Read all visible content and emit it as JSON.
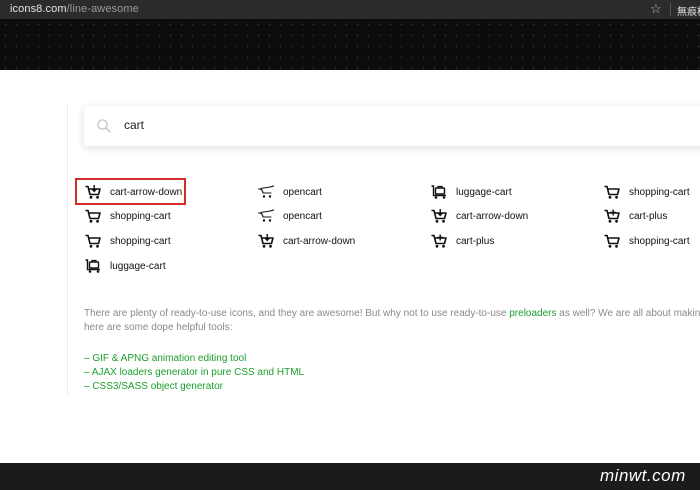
{
  "browser": {
    "url_host": "icons8.com",
    "url_path": "/line-awesome",
    "mode_label": "無痕模式"
  },
  "search": {
    "value": "cart"
  },
  "results": [
    {
      "label": "cart-arrow-down",
      "icon": "cart-arrow-down-icon"
    },
    {
      "label": "opencart",
      "icon": "opencart-icon"
    },
    {
      "label": "luggage-cart",
      "icon": "luggage-cart-icon"
    },
    {
      "label": "shopping-cart",
      "icon": "shopping-cart-icon"
    },
    {
      "label": "shopping-cart",
      "icon": "shopping-cart-icon"
    },
    {
      "label": "opencart",
      "icon": "opencart-icon"
    },
    {
      "label": "cart-arrow-down",
      "icon": "cart-arrow-down-icon"
    },
    {
      "label": "cart-plus",
      "icon": "cart-plus-icon"
    },
    {
      "label": "shopping-cart",
      "icon": "shopping-cart-icon"
    },
    {
      "label": "cart-arrow-down",
      "icon": "cart-arrow-down-icon"
    },
    {
      "label": "cart-plus",
      "icon": "cart-plus-icon"
    },
    {
      "label": "shopping-cart",
      "icon": "shopping-cart-icon"
    },
    {
      "label": "luggage-cart",
      "icon": "luggage-cart-icon"
    }
  ],
  "info": {
    "line1_before": "There are plenty of ready-to-use icons, and they are awesome! But why not to use ready-to-use ",
    "line1_link": "preloaders",
    "line1_after": " as well? We are all about making your li",
    "line2": "here are some dope helpful tools:"
  },
  "tools": [
    "– GIF & APNG animation editing tool",
    "– AJAX loaders generator in pure CSS and HTML",
    "– CSS3/SASS object generator"
  ],
  "watermark": "minwt.com",
  "colors": {
    "link": "#1b9e2c",
    "highlight": "#d32a2a",
    "header": "#0c0c0c"
  }
}
